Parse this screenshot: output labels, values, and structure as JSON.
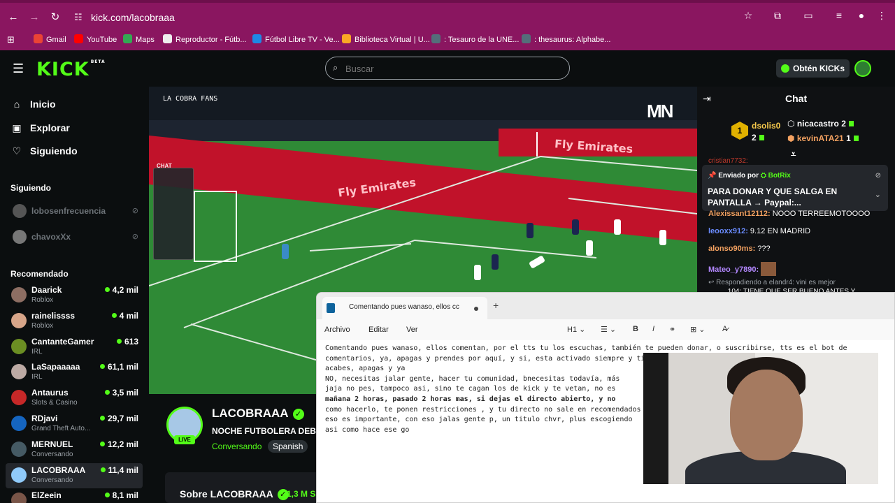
{
  "browser": {
    "url": "kick.com/lacobraaa",
    "bookmarks": [
      {
        "label": "Gmail",
        "color": "#ea4335"
      },
      {
        "label": "YouTube",
        "color": "#ff0000"
      },
      {
        "label": "Maps",
        "color": "#34a853"
      },
      {
        "label": "Reproductor - Fútb...",
        "color": "#eeeeee"
      },
      {
        "label": "Fútbol Libre TV - Ve...",
        "color": "#1e88e5"
      },
      {
        "label": "Biblioteca Virtual | U...",
        "color": "#f9a825"
      },
      {
        "label": ": Tesauro de la UNE...",
        "color": "#546e7a"
      },
      {
        "label": ": thesaurus: Alphabe...",
        "color": "#546e7a"
      }
    ]
  },
  "kick": {
    "logo": "KICK",
    "logo_badge": "BETA",
    "search_placeholder": "Buscar",
    "kicks_button": "Obtén KICKs"
  },
  "sidebar": {
    "nav": [
      {
        "label": "Inicio",
        "icon": "home-icon"
      },
      {
        "label": "Explorar",
        "icon": "compass-icon"
      },
      {
        "label": "Siguiendo",
        "icon": "heart-icon"
      }
    ],
    "following_title": "Siguiendo",
    "following": [
      {
        "name": "lobosenfrecuencia"
      },
      {
        "name": "chavoxXx"
      }
    ],
    "recommended_title": "Recomendado",
    "recommended": [
      {
        "name": "Daarick",
        "category": "Roblox",
        "viewers": "4,2 mil",
        "color": "#8d6e63"
      },
      {
        "name": "rainelissss",
        "category": "Roblox",
        "viewers": "4 mil",
        "color": "#d7a589"
      },
      {
        "name": "CantanteGamer",
        "category": "IRL",
        "viewers": "613",
        "color": "#6b8e23"
      },
      {
        "name": "LaSapaaaaa",
        "category": "IRL",
        "viewers": "61,1 mil",
        "color": "#bcaaa4"
      },
      {
        "name": "Antaurus",
        "category": "Slots & Casino",
        "viewers": "3,5 mil",
        "color": "#c62828"
      },
      {
        "name": "RDjavi",
        "category": "Grand Theft Auto...",
        "viewers": "29,7 mil",
        "color": "#1565c0"
      },
      {
        "name": "MERNUEL",
        "category": "Conversando",
        "viewers": "12,2 mil",
        "color": "#455a64"
      },
      {
        "name": "LACOBRAAA",
        "category": "Conversando",
        "viewers": "11,4 mil",
        "color": "#90caf9"
      },
      {
        "name": "ElZeein",
        "category": "",
        "viewers": "8,1 mil",
        "color": "#795548"
      }
    ]
  },
  "video": {
    "overlay_brand": "LA COBRA FANS",
    "overlay_logo": "MN",
    "overlay_chat": "CHAT",
    "ad_text": "Fly Emirates"
  },
  "channel": {
    "name": "LACOBRAAA",
    "title": "NOCHE FUTBOLERA DEBA",
    "category": "Conversando",
    "language": "Spanish",
    "live": "LIVE",
    "about": "Sobre LACOBRAAA",
    "followers": "1,3 M S"
  },
  "chat": {
    "title": "Chat",
    "leaderboard": {
      "first": {
        "rank": "1",
        "name": "dsolis0",
        "count": "2"
      },
      "second": {
        "name": "nicacastro",
        "count": "2"
      },
      "third": {
        "name": "kevinATA21",
        "count": "1"
      }
    },
    "partial_top": "cristian7732:",
    "pinned": {
      "prefix": "Enviado por",
      "bot": "BotRix",
      "message": "PARA DONAR Y QUE SALGA EN PANTALLA → Paypal:..."
    },
    "messages": [
      {
        "user": "Alexissant12112:",
        "text": " NOOO TERREEMOTOOOO",
        "color": "#f4a261"
      },
      {
        "user": "leooxx912:",
        "text": " 9.12 EN MADRID",
        "color": "#5b8def"
      },
      {
        "user": "alonso90ms:",
        "text": " ???",
        "color": "#f4a261"
      },
      {
        "user": "Mateo_y7890:",
        "text": "",
        "color": "#b388ff"
      }
    ],
    "reply_note": "Respondiendo a elandr4: vini es mejor",
    "reply_partial": "_____104: TIENE QUE SER BUENO ANTES Y"
  },
  "notepad": {
    "tab_title": "Comentando pues wanaso, ellos cc",
    "menus": [
      "Archivo",
      "Editar",
      "Ver"
    ],
    "heading_selector": "H1",
    "lines": [
      "Comentando pues wanaso, ellos comentan, por el tts tu los escuchas, también te pueden donar, o suscribirse, tts es el bot de",
      "comentarios, ya, apagas y prendes por aquí, y si, esta activado siempre y tienes que pedir un número de suscripciones, lo permisos",
      "acabes, apagas y ya",
      "NO, necesitas jalar gente, hacer tu comunidad, bnecesitas todavía, más",
      "jaja no pes, tampoco asi, sino te cagan los de kick y te vetan, no es",
      "mañana 2 horas, pasado 2 horas mas, si dejas el directo abierto, y no",
      "como hacerlo, te ponen restricciones , y tu directo no sale en recomendados",
      "eso es importante, con eso jalas gente p, un titulo chvr, plus escogiendo",
      "asi como hace ese go"
    ]
  }
}
